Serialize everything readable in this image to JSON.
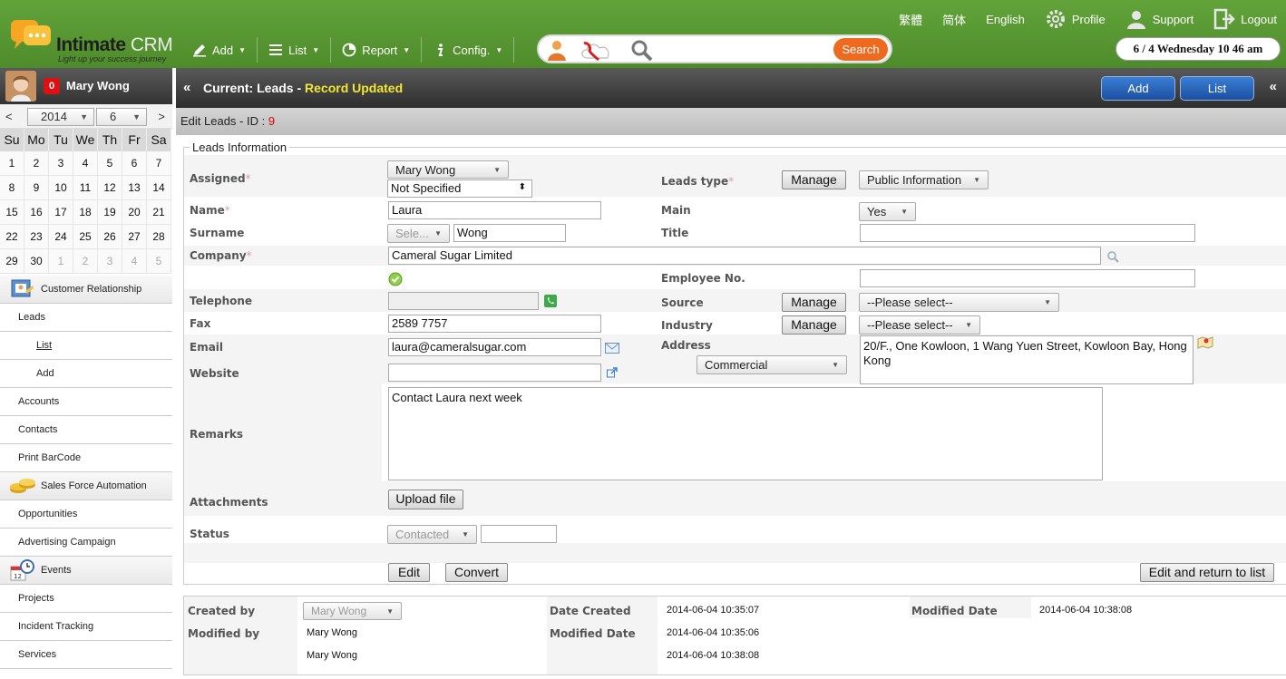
{
  "header": {
    "logo_main": "Intimate",
    "logo_crm": "CRM",
    "logo_tagline": "Light up your success journey",
    "top_links": [
      {
        "label": "繁體"
      },
      {
        "label": "简体"
      },
      {
        "label": "English"
      },
      {
        "label": "Profile",
        "icon": "gear-icon"
      },
      {
        "label": "Support",
        "icon": "user-icon"
      },
      {
        "label": "Logout",
        "icon": "logout-icon"
      }
    ],
    "menu": [
      {
        "label": "Add",
        "icon": "pencil-icon"
      },
      {
        "label": "List",
        "icon": "list-icon"
      },
      {
        "label": "Report",
        "icon": "report-icon"
      },
      {
        "label": "Config.",
        "icon": "info-icon"
      }
    ],
    "search_placeholder": "",
    "search_button": "Search",
    "datetime": "6 / 4  Wednesday  10 46 am",
    "accent_color": "#5a9a34"
  },
  "user": {
    "name": "Mary Wong",
    "badge_count": "0"
  },
  "calendar": {
    "prev": "<",
    "next": ">",
    "year": "2014",
    "month": "6",
    "day_headers": [
      "Su",
      "Mo",
      "Tu",
      "We",
      "Th",
      "Fr",
      "Sa"
    ],
    "days": [
      "1",
      "2",
      "3",
      "4",
      "5",
      "6",
      "7",
      "8",
      "9",
      "10",
      "11",
      "12",
      "13",
      "14",
      "15",
      "16",
      "17",
      "18",
      "19",
      "20",
      "21",
      "22",
      "23",
      "24",
      "25",
      "26",
      "27",
      "28",
      "29",
      "30",
      "1",
      "2",
      "3",
      "4",
      "5"
    ]
  },
  "nav": [
    {
      "type": "section",
      "label": "Customer Relationship",
      "icon": "contacts-card-icon"
    },
    {
      "type": "item",
      "label": "Leads"
    },
    {
      "type": "sub",
      "label": "List",
      "active": true
    },
    {
      "type": "sub",
      "label": "Add"
    },
    {
      "type": "item",
      "label": "Accounts"
    },
    {
      "type": "item",
      "label": "Contacts"
    },
    {
      "type": "item",
      "label": "Print BarCode"
    },
    {
      "type": "section",
      "label": "Sales Force Automation",
      "icon": "coins-icon"
    },
    {
      "type": "item",
      "label": "Opportunities"
    },
    {
      "type": "item",
      "label": "Advertising Campaign"
    },
    {
      "type": "section",
      "label": "Events",
      "icon": "calendar-clock-icon"
    },
    {
      "type": "item",
      "label": "Projects"
    },
    {
      "type": "item",
      "label": "Incident Tracking"
    },
    {
      "type": "item",
      "label": "Services"
    }
  ],
  "page": {
    "current_label": "Current: Leads - ",
    "status": "Record Updated",
    "add_button": "Add",
    "list_button": "List",
    "edit_label": "Edit Leads - ID : ",
    "record_id": "9",
    "legend": "Leads Information"
  },
  "form": {
    "assigned_label": "Assigned",
    "assigned_value": "Mary Wong",
    "assigned_specified": "Not Specified",
    "leads_type_label": "Leads type",
    "manage": "Manage",
    "leads_type_value": "Public Information",
    "name_label": "Name",
    "name_value": "Laura",
    "main_label": "Main",
    "main_value": "Yes",
    "surname_label": "Surname",
    "surname_prefix": "Sele...",
    "surname_value": "Wong",
    "title_label": "Title",
    "title_value": "",
    "company_label": "Company",
    "company_value": "Cameral Sugar Limited",
    "employee_label": "Employee No.",
    "employee_value": "",
    "telephone_label": "Telephone",
    "telephone_value": "",
    "source_label": "Source",
    "source_value": "--Please select--",
    "fax_label": "Fax",
    "fax_value": "2589 7757",
    "industry_label": "Industry",
    "industry_value": "--Please select--",
    "email_label": "Email",
    "email_value": "laura@cameralsugar.com",
    "address_label": "Address",
    "address_type": "Commercial",
    "address_value": "20/F., One Kowloon, 1 Wang Yuen Street, Kowloon Bay, Hong Kong",
    "website_label": "Website",
    "website_value": "",
    "remarks_label": "Remarks",
    "remarks_value": "Contact Laura next week",
    "attachments_label": "Attachments",
    "upload_button": "Upload file",
    "status_label": "Status",
    "status_value": "Contacted",
    "status_extra": "",
    "edit_button": "Edit",
    "convert_button": "Convert",
    "edit_return_button": "Edit and return to list"
  },
  "info": {
    "created_by_label": "Created by",
    "created_by_value": "Mary Wong",
    "modified_by_label": "Modified by",
    "modified_by_1": "Mary Wong",
    "modified_by_2": "Mary Wong",
    "date_created_label": "Date Created",
    "date_created_value": "2014-06-04 10:35:07",
    "modified_date_label": "Modified Date",
    "modified_date_1": "2014-06-04 10:35:06",
    "modified_date_2": "2014-06-04 10:38:08",
    "modified_date_label_right": "Modified Date",
    "modified_date_right_value": "2014-06-04 10:38:08"
  }
}
